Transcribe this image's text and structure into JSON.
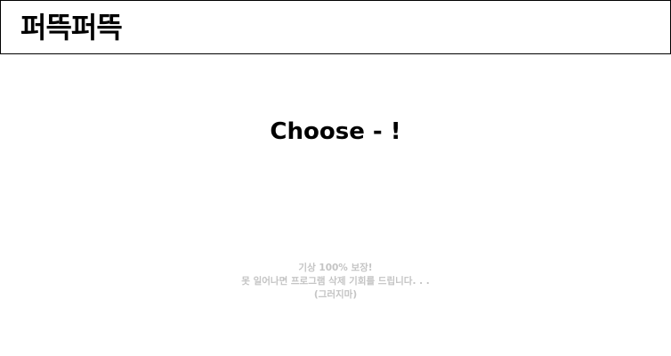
{
  "header": {
    "logo_text": "퍼뜩퍼뜩"
  },
  "main": {
    "title": "Choose - !",
    "notice_lines": [
      "기상 100% 보장!",
      "못 일어나면 프로그램 삭제 기회를 드립니다. . .",
      "(그러지마)"
    ]
  },
  "colors": {
    "border": "#000000",
    "title": "#000000",
    "notice": "#c4c4c4",
    "background": "#ffffff"
  }
}
